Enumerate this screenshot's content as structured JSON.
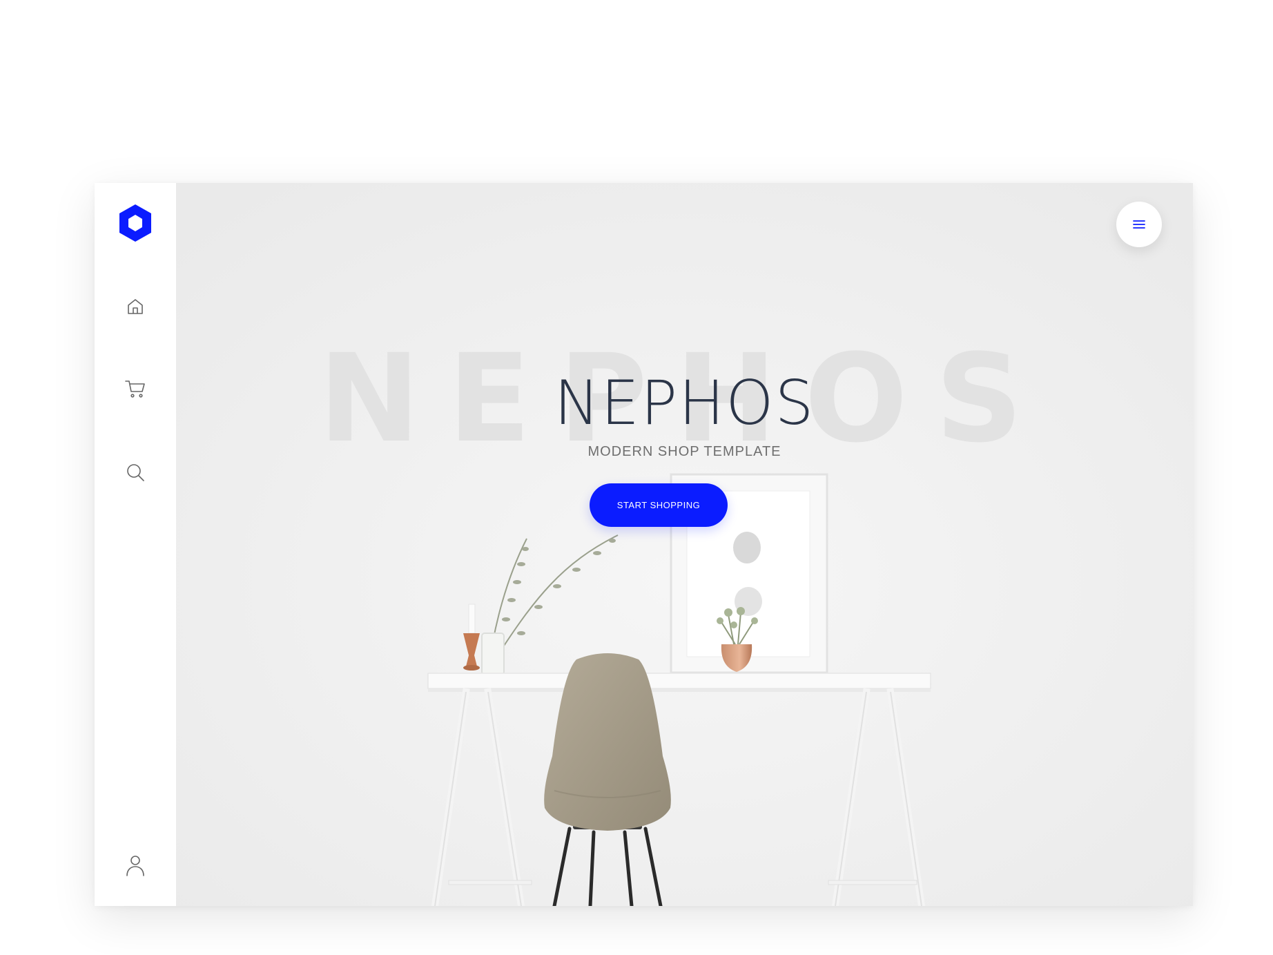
{
  "brand": {
    "title": "NEPHOS",
    "background_word": "NEPHOS",
    "subtitle": "MODERN SHOP TEMPLATE",
    "accent_color": "#0b1cff"
  },
  "hero": {
    "cta_label": "START SHOPPING"
  },
  "sidebar": {
    "logo_icon": "hexagon-logo-icon",
    "items": [
      {
        "icon": "home-icon"
      },
      {
        "icon": "cart-icon"
      },
      {
        "icon": "search-icon"
      }
    ],
    "bottom_icon": "user-icon"
  },
  "header": {
    "menu_icon": "hamburger-menu-icon"
  }
}
